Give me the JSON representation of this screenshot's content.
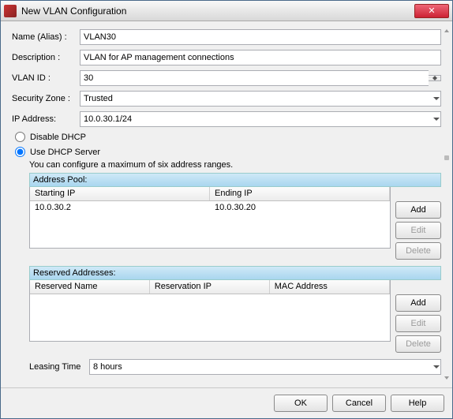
{
  "window": {
    "title": "New VLAN Configuration"
  },
  "labels": {
    "name": "Name (Alias) :",
    "description": "Description :",
    "vlan_id": "VLAN ID :",
    "security_zone": "Security Zone :",
    "ip_address": "IP Address:",
    "disable_dhcp": "Disable DHCP",
    "use_dhcp": "Use DHCP Server",
    "leasing_time": "Leasing Time"
  },
  "values": {
    "name": "VLAN30",
    "description": "VLAN for AP management connections",
    "vlan_id": "30",
    "security_zone": "Trusted",
    "ip_address": "10.0.30.1/24",
    "leasing_time": "8 hours"
  },
  "dhcp": {
    "mode": "use_dhcp",
    "hint": "You can configure a maximum of six address ranges.",
    "address_pool": {
      "title": "Address Pool:",
      "columns": [
        "Starting IP",
        "Ending IP"
      ],
      "rows": [
        {
          "start": "10.0.30.2",
          "end": "10.0.30.20"
        }
      ],
      "buttons": {
        "add": "Add",
        "edit": "Edit",
        "delete": "Delete"
      }
    },
    "reserved": {
      "title": "Reserved Addresses:",
      "columns": [
        "Reserved Name",
        "Reservation IP",
        "MAC Address"
      ],
      "rows": [],
      "buttons": {
        "add": "Add",
        "edit": "Edit",
        "delete": "Delete"
      }
    }
  },
  "footer": {
    "ok": "OK",
    "cancel": "Cancel",
    "help": "Help"
  }
}
